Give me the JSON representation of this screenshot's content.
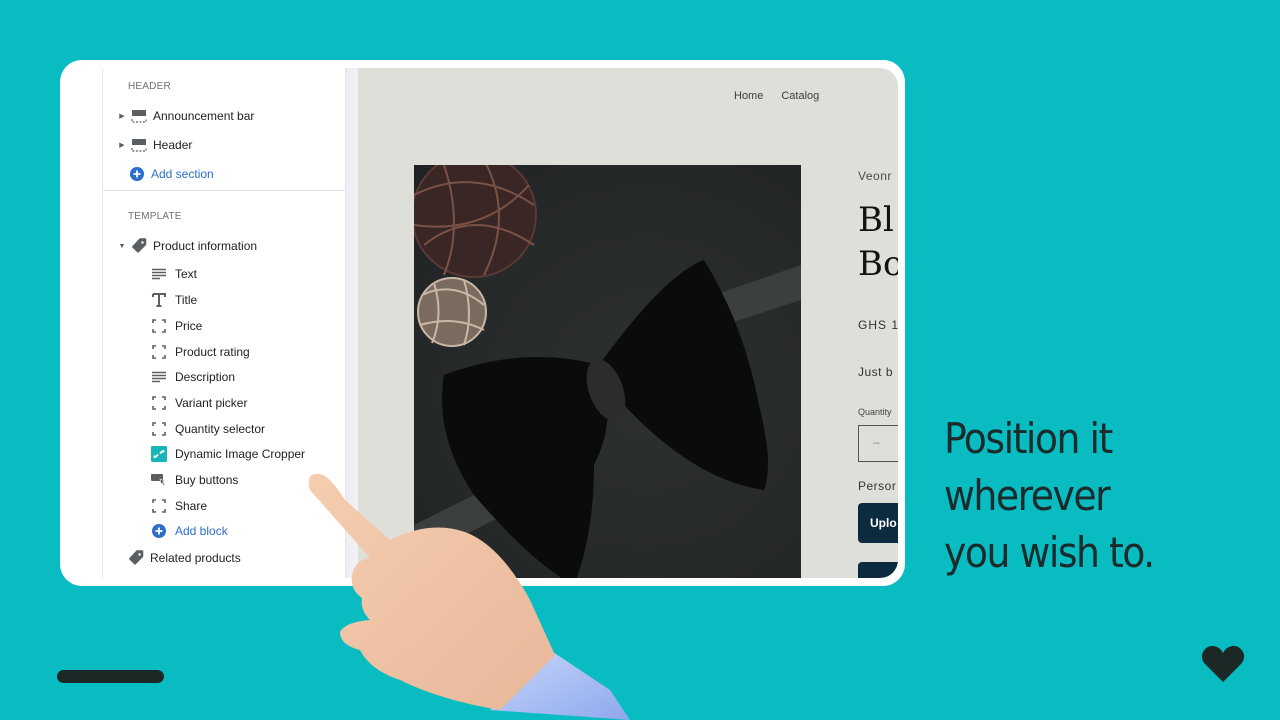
{
  "sidebar": {
    "header_section": {
      "title": "HEADER",
      "items": [
        {
          "label": "Announcement bar",
          "icon": "layout-section-icon",
          "expandable": true
        },
        {
          "label": "Header",
          "icon": "layout-section-icon",
          "expandable": true
        }
      ],
      "add_label": "Add section"
    },
    "template_section": {
      "title": "TEMPLATE",
      "group": {
        "label": "Product information",
        "icon": "tag-icon",
        "expanded": true
      },
      "blocks": [
        {
          "label": "Text",
          "icon": "text-lines-icon"
        },
        {
          "label": "Title",
          "icon": "title-t-icon"
        },
        {
          "label": "Price",
          "icon": "dashed-frame-icon"
        },
        {
          "label": "Product rating",
          "icon": "dashed-frame-icon"
        },
        {
          "label": "Description",
          "icon": "text-lines-icon"
        },
        {
          "label": "Variant picker",
          "icon": "dashed-frame-icon"
        },
        {
          "label": "Quantity selector",
          "icon": "dashed-frame-icon"
        },
        {
          "label": "Dynamic Image Cropper",
          "icon": "app-cropper-icon"
        },
        {
          "label": "Buy buttons",
          "icon": "buy-button-icon"
        },
        {
          "label": "Share",
          "icon": "dashed-frame-icon"
        }
      ],
      "add_block_label": "Add block",
      "related": {
        "label": "Related products",
        "icon": "tag-icon"
      }
    }
  },
  "preview": {
    "nav": [
      "Home",
      "Catalog"
    ],
    "vendor": "Veonr",
    "title_lines": [
      "Bl",
      "Bo"
    ],
    "price": "GHS 1",
    "description": "Just b",
    "quantity_label": "Quantity",
    "quantity_minus": "–",
    "personalize_label": "Persor",
    "upload_label": "Uplo"
  },
  "headline": [
    "Position it",
    "wherever",
    "you wish to."
  ],
  "colors": {
    "background": "#08bcc2",
    "accent_link": "#2c6ecb",
    "button_dark": "#0d2b3e",
    "text_dark": "#1b2b2b",
    "cropper_icon": "#17b5b9"
  }
}
